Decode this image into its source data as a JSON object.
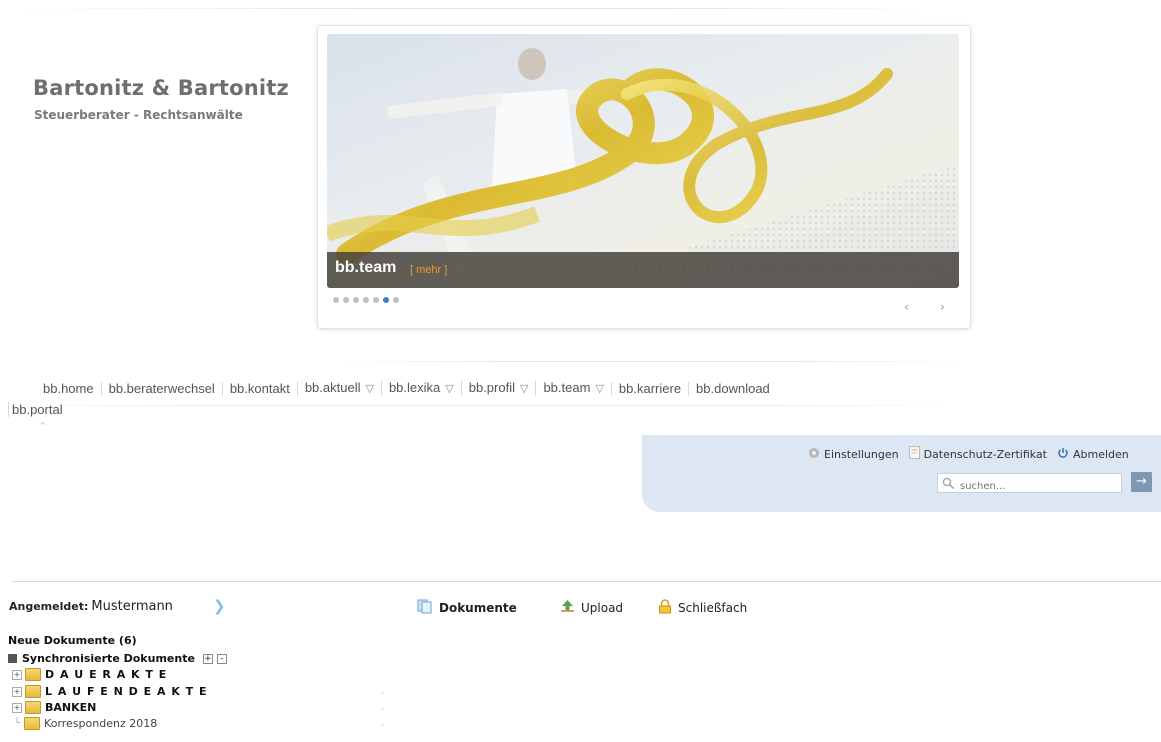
{
  "brand": {
    "name": "Bartonitz & Bartonitz",
    "tagline": "Steuerberater - Rechtsanwälte"
  },
  "slider": {
    "caption": "bb.team",
    "more": "[ mehr ]",
    "dots": 7,
    "active_dot": 5,
    "prev": "‹",
    "next": "›"
  },
  "nav": {
    "items": [
      {
        "label": "bb.home",
        "dropdown": false
      },
      {
        "label": "bb.beraterwechsel",
        "dropdown": false
      },
      {
        "label": "bb.kontakt",
        "dropdown": false
      },
      {
        "label": "bb.aktuell",
        "dropdown": true
      },
      {
        "label": "bb.lexika",
        "dropdown": true
      },
      {
        "label": "bb.profil",
        "dropdown": true
      },
      {
        "label": "bb.team",
        "dropdown": true
      },
      {
        "label": "bb.karriere",
        "dropdown": false
      },
      {
        "label": "bb.download",
        "dropdown": false
      }
    ],
    "portal": "bb.portal",
    "dropdown_glyph": "▽"
  },
  "user_toolbar": {
    "settings": "Einstellungen",
    "privacy_cert": "Datenschutz-Zertifikat",
    "logout": "Abmelden",
    "search_placeholder": "suchen...",
    "go": "→"
  },
  "portal": {
    "logged_in_label": "Angemeldet:",
    "username": "Mustermann",
    "tabs": {
      "documents": "Dokumente",
      "upload": "Upload",
      "safe": "Schließfach"
    },
    "new_documents": "Neue Dokumente (6)",
    "synced": "Synchronisierte Dokumente",
    "plus": "+",
    "minus": "-",
    "folders": [
      {
        "name": "D A U E R A K T E",
        "bold": true,
        "expander": "+",
        "clip": false
      },
      {
        "name": "L A U F E N D E A K T E",
        "bold": true,
        "expander": "+",
        "clip": true
      },
      {
        "name": "BANKEN",
        "bold": true,
        "expander": "+",
        "clip": true
      },
      {
        "name": "Korrespondenz 2018",
        "bold": false,
        "expander": "└",
        "clip": true
      }
    ]
  },
  "colors": {
    "accent_blue": "#3c7fc4",
    "panel_bg": "#dde7f3",
    "more_orange": "#f39a2b"
  }
}
